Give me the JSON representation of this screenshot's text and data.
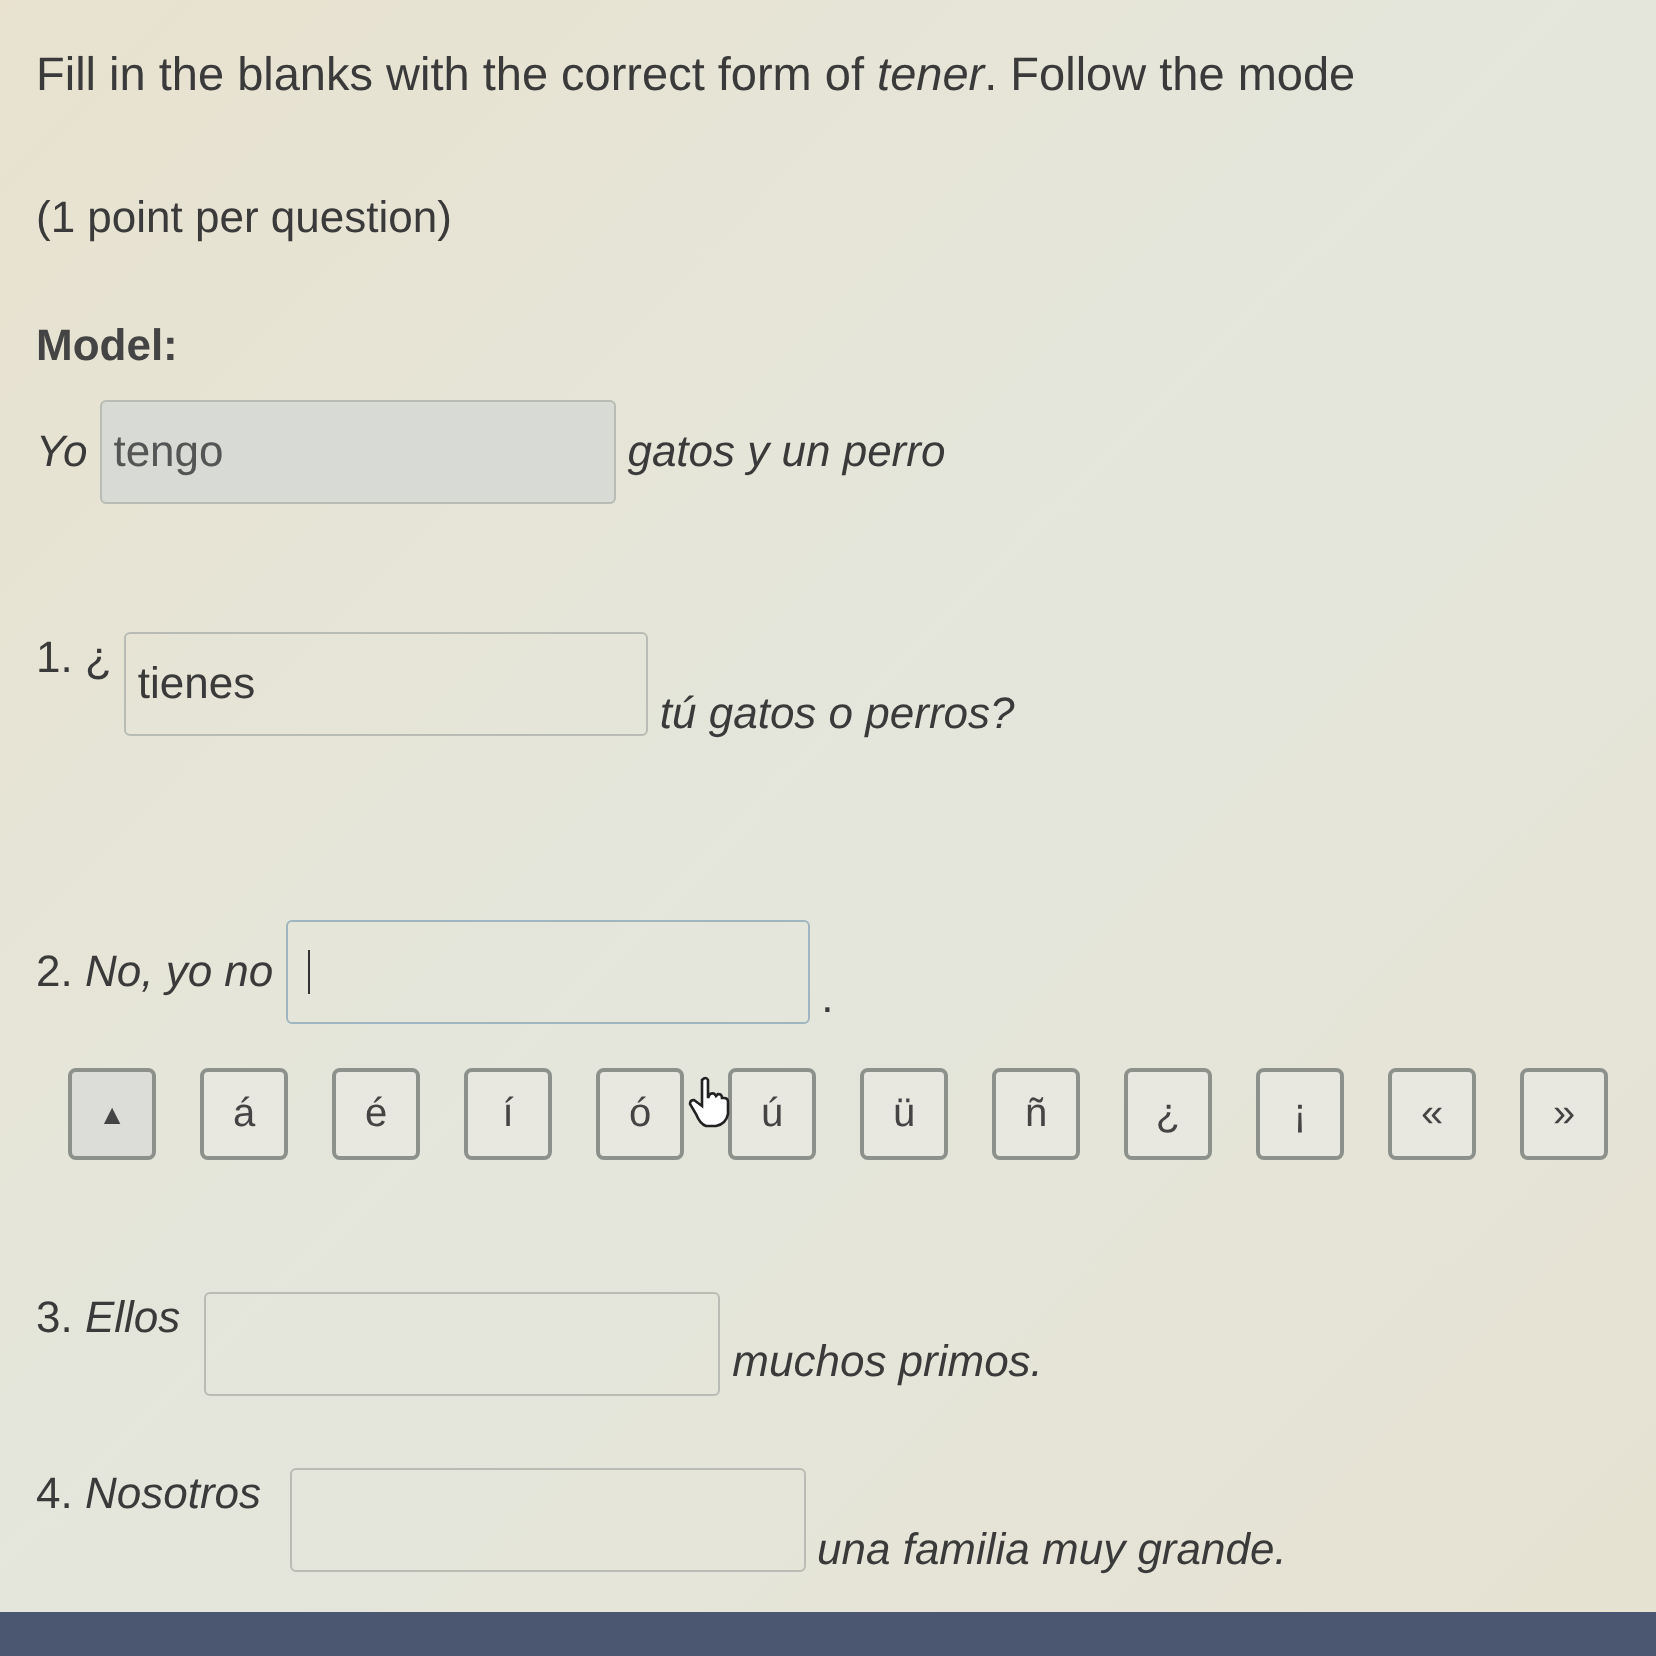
{
  "instructions": "Fill in the blanks with the correct form of *tener*. Follow the mode",
  "points": "(1 point per question)",
  "model": {
    "heading": "Model:",
    "before": "*Yo*",
    "value": "tengo",
    "after": "*gatos y un perro*",
    "disabled": true,
    "focused": false
  },
  "questions": [
    {
      "before": "1. ¿",
      "value": "tienes",
      "after": "*tú gatos o perros?*",
      "focused": false,
      "disabled": false
    },
    {
      "before": "2. *No, yo no*",
      "after": ".",
      "focused": true,
      "disabled": false
    },
    {
      "before": "3. *Ellos*",
      "after": "*muchos primos.*",
      "focused": false,
      "disabled": false
    },
    {
      "before": "4. *Nosotros*",
      "after": "*una familia muy grande.*",
      "focused": false,
      "disabled": false
    }
  ],
  "accent_keys": [
    "▲",
    "á",
    "é",
    "í",
    "ó",
    "ú",
    "ü",
    "ñ",
    "¿",
    "¡",
    "«",
    "»"
  ]
}
